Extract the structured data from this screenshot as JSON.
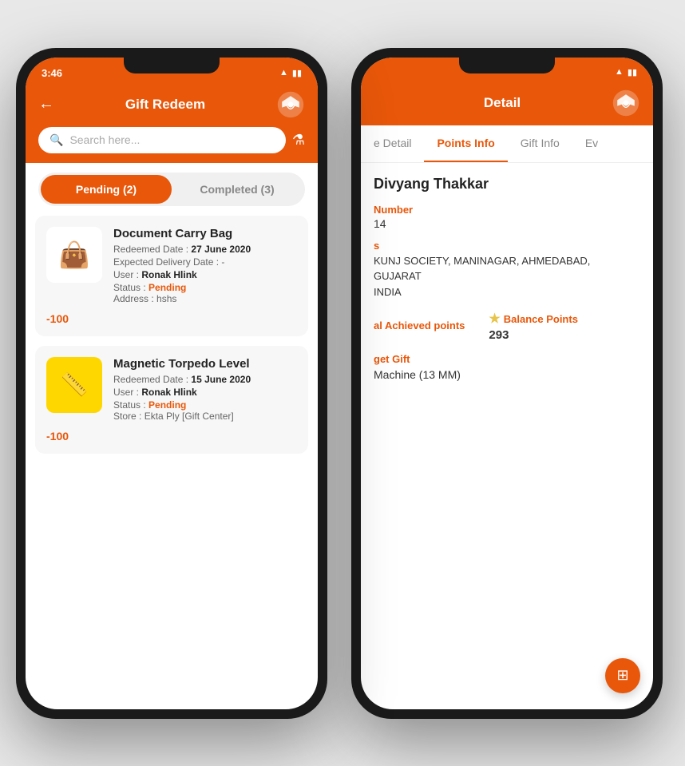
{
  "left_phone": {
    "status_bar": {
      "time": "3:46",
      "icons": "▲ ⌕ ▮▮▮"
    },
    "header": {
      "back_label": "←",
      "title": "Gift Redeem",
      "logo_alt": "brand-logo"
    },
    "search": {
      "placeholder": "Search here...",
      "filter_icon": "filter"
    },
    "tabs": [
      {
        "label": "Pending (2)",
        "active": true
      },
      {
        "label": "Completed (3)",
        "active": false
      }
    ],
    "gifts": [
      {
        "id": "gift-1",
        "name": "Document Carry Bag",
        "icon": "👜",
        "redeemed_date_label": "Redeemed Date :",
        "redeemed_date": "27 June 2020",
        "delivery_date_label": "Expected Delivery Date :",
        "delivery_date": "-",
        "user_label": "User :",
        "user": "Ronak Hlink",
        "status_label": "Status :",
        "status": "Pending",
        "address_label": "Address :",
        "address": "hshs",
        "points": "-100"
      },
      {
        "id": "gift-2",
        "name": "Magnetic Torpedo Level",
        "icon": "📏",
        "redeemed_date_label": "Redeemed Date :",
        "redeemed_date": "15 June 2020",
        "delivery_date_label": null,
        "delivery_date": null,
        "user_label": "User :",
        "user": "Ronak Hlink",
        "status_label": "Status :",
        "status": "Pending",
        "store_label": "Store :",
        "store": "Ekta Ply [Gift Center]",
        "points": "-100"
      }
    ]
  },
  "right_phone": {
    "status_bar": {
      "time": "",
      "icons": "⌕ ▮▮"
    },
    "header": {
      "title": "Detail",
      "logo_alt": "brand-logo"
    },
    "tabs": [
      {
        "label": "e Detail",
        "active": false
      },
      {
        "label": "Points Info",
        "active": true
      },
      {
        "label": "Gift Info",
        "active": false
      },
      {
        "label": "Ev",
        "active": false
      }
    ],
    "detail": {
      "user_name": "Divyang Thakkar",
      "number_label": "Number",
      "number_value": "14",
      "address_label": "s",
      "address_value": "KUNJ SOCIETY, MANINAGAR, AHMEDABAD, GUJARAT\nINDIA",
      "achieved_points_label": "al Achieved points",
      "achieved_points_value": "",
      "balance_points_label": "Balance Points",
      "balance_points_value": "293",
      "get_gift_label": "get Gift",
      "get_gift_value": "Machine (13 MM)"
    },
    "fab_icon": "⊞"
  }
}
